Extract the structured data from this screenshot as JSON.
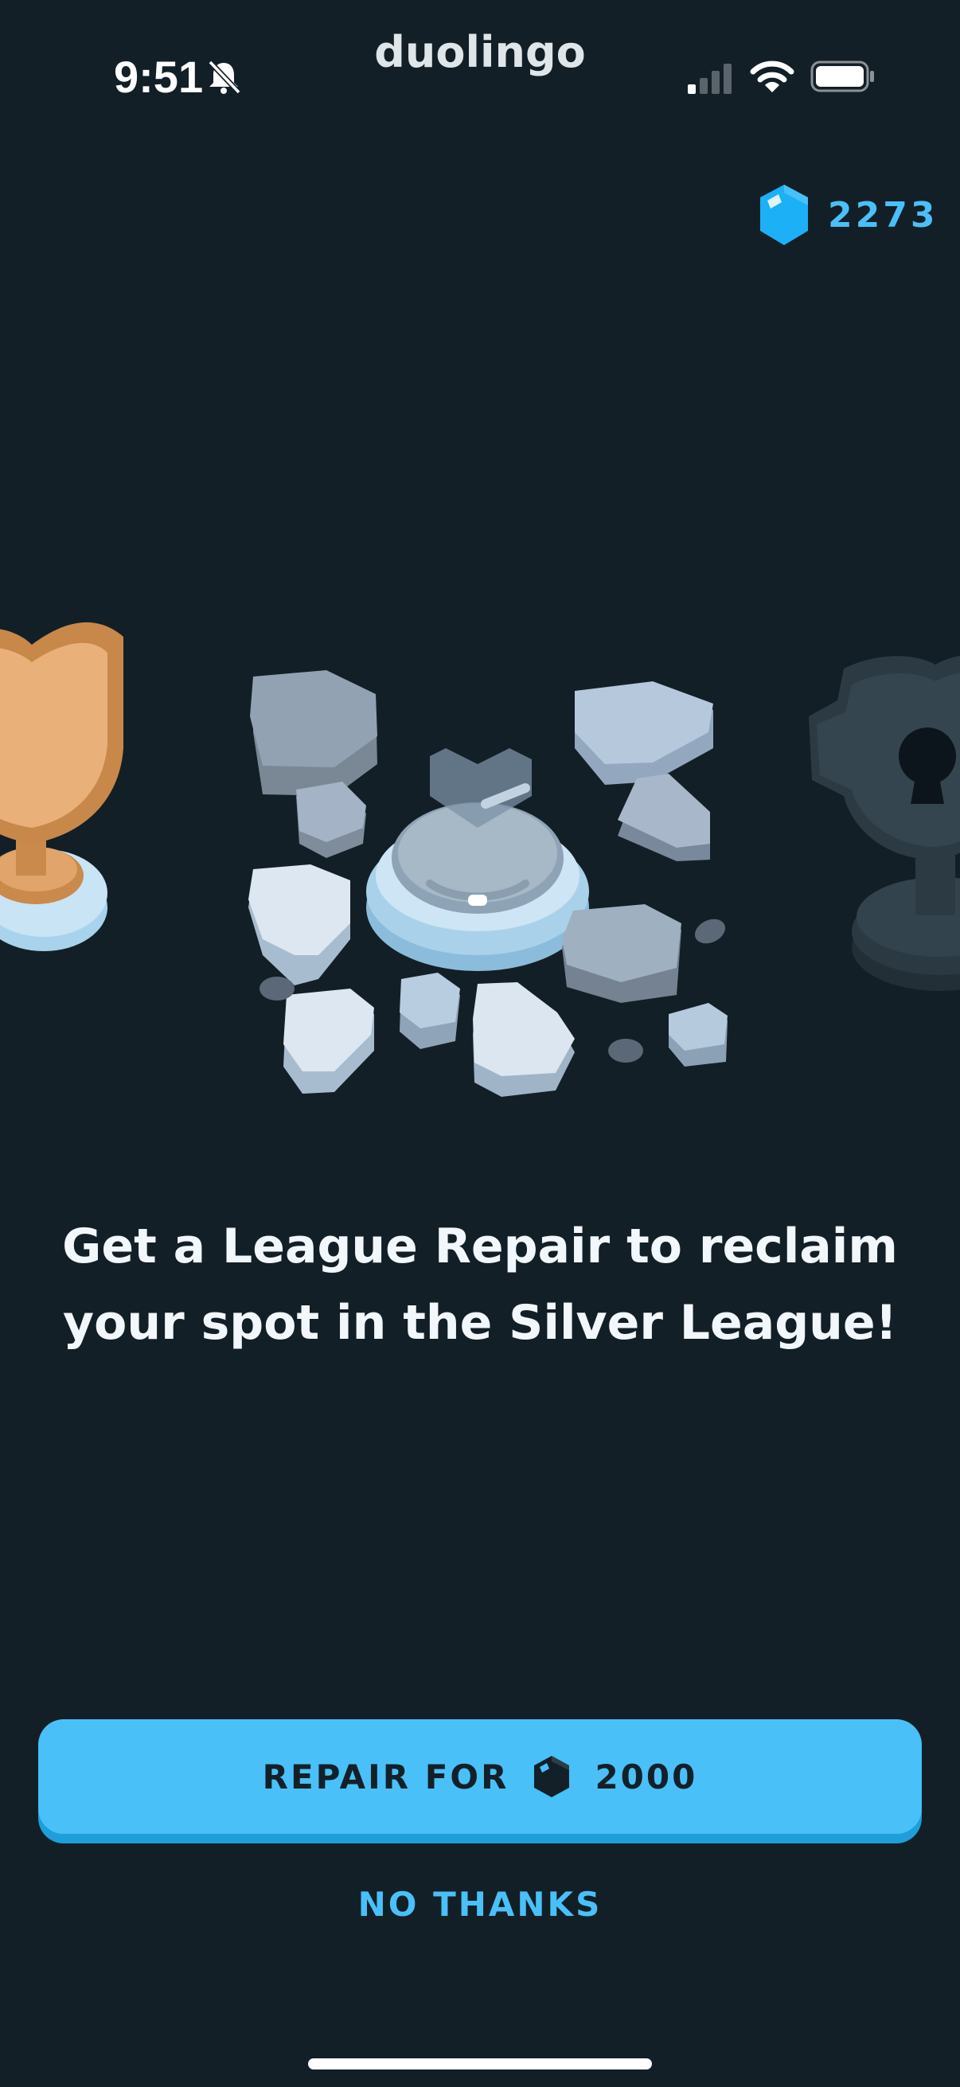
{
  "status_bar": {
    "time": "9:51",
    "icons": [
      "bell-slash-icon",
      "signal-icon",
      "wifi-icon",
      "battery-icon"
    ]
  },
  "app": {
    "name": "duolingo"
  },
  "gems": {
    "count": "2273",
    "icon": "gem-icon",
    "color": "#49c0f8"
  },
  "illustration": {
    "items": [
      "bronze-trophy",
      "shattered-silver-trophy",
      "locked-trophy"
    ]
  },
  "headline": {
    "line1": "Get a League Repair to reclaim",
    "line2": "your spot in the Silver League!"
  },
  "repair_button": {
    "label": "REPAIR FOR",
    "cost": "2000",
    "icon": "gem-icon"
  },
  "no_thanks": {
    "label": "NO THANKS"
  },
  "colors": {
    "background": "#131f26",
    "accent": "#49c0f8",
    "accent_dark": "#1d9fd9",
    "text": "#f1f7fa"
  }
}
